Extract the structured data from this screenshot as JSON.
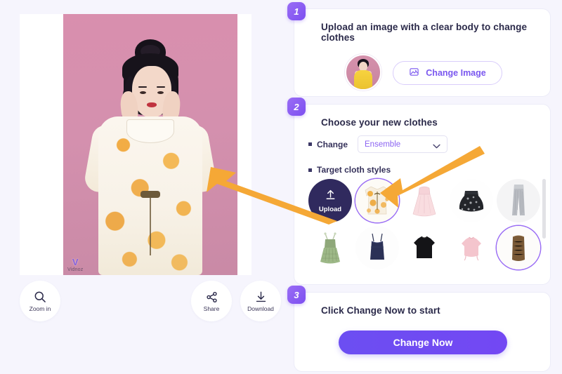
{
  "app": {
    "background_color": "#f6f5fd",
    "accent_color": "#7d4ff0",
    "annotation_color": "#f5a836"
  },
  "preview": {
    "watermark_logo": "V",
    "watermark_text": "Vidnoz",
    "photo_description": "Woman with hair bun in floral kimono on pink background"
  },
  "toolbar": {
    "buttons": [
      {
        "label": "Zoom in",
        "icon": "search-icon"
      },
      {
        "label": "Share",
        "icon": "share-icon"
      },
      {
        "label": "Download",
        "icon": "download-icon"
      }
    ]
  },
  "steps": [
    {
      "number": "1",
      "title": "Upload an image with a clear body to change clothes",
      "change_image_label": "Change Image",
      "change_image_icon": "image-icon"
    },
    {
      "number": "2",
      "title": "Choose your new clothes",
      "change_label": "Change",
      "change_value": "Ensemble",
      "change_options": [
        "Ensemble"
      ],
      "styles_label": "Target cloth styles",
      "upload_label": "Upload",
      "upload_icon": "upload-arrow-icon",
      "thumbnails": [
        {
          "name": "floral-kimono",
          "selected": true
        },
        {
          "name": "pink-lace-dress",
          "selected": false
        },
        {
          "name": "black-floral-skirt",
          "selected": false
        },
        {
          "name": "grey-wide-leg-jeans",
          "selected": false
        },
        {
          "name": "green-gingham-dress",
          "selected": false
        },
        {
          "name": "navy-camisole-top",
          "selected": false
        },
        {
          "name": "black-tshirt",
          "selected": false
        },
        {
          "name": "pink-crop-top",
          "selected": false
        },
        {
          "name": "brown-ruched-dress",
          "selected": true
        }
      ]
    },
    {
      "number": "3",
      "title": "Click Change Now to start",
      "cta_label": "Change Now"
    }
  ]
}
